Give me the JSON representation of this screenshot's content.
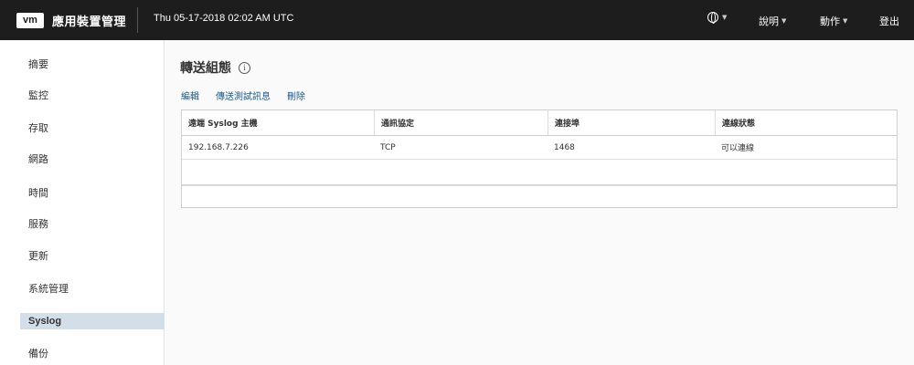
{
  "header": {
    "logo": "vm",
    "title": "應用裝置管理",
    "datetime": "Thu 05-17-2018 02:02 AM UTC",
    "help": "說明",
    "actions": "動作",
    "logout": "登出"
  },
  "sidebar": {
    "items": [
      {
        "label": "摘要"
      },
      {
        "label": "監控"
      },
      {
        "label": "存取"
      },
      {
        "label": "網路"
      },
      {
        "label": "時間"
      },
      {
        "label": "服務"
      },
      {
        "label": "更新"
      },
      {
        "label": "系統管理"
      },
      {
        "label": "Syslog",
        "active": true
      },
      {
        "label": "備份"
      }
    ]
  },
  "main": {
    "title": "轉送組態",
    "toolbar": {
      "edit": "編輯",
      "send_test": "傳送測試訊息",
      "delete": "刪除"
    },
    "table": {
      "columns": [
        "遠端 Syslog 主機",
        "通訊協定",
        "連接埠",
        "連線狀態"
      ],
      "rows": [
        [
          "192.168.7.226",
          "TCP",
          "1468",
          "可以連線"
        ]
      ]
    }
  }
}
